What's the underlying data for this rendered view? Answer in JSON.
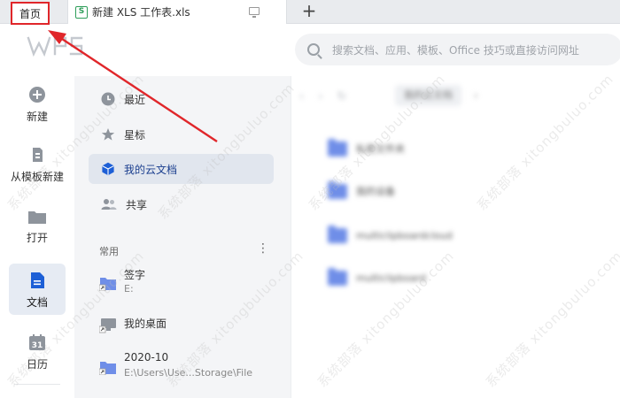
{
  "tabs": {
    "home_label": "首页",
    "file_label": "新建 XLS 工作表.xls",
    "file_icon": "S",
    "new_tab": "+"
  },
  "search": {
    "placeholder": "搜索文档、应用、模板、Office 技巧或直接访问网址"
  },
  "rail": {
    "items": [
      {
        "label": "新建"
      },
      {
        "label": "从模板新建"
      },
      {
        "label": "打开"
      },
      {
        "label": "文档"
      },
      {
        "label": "日历"
      }
    ],
    "calendar_day": "31"
  },
  "nav": {
    "items": [
      {
        "label": "最近"
      },
      {
        "label": "星标"
      },
      {
        "label": "我的云文档"
      },
      {
        "label": "共享"
      }
    ],
    "section_title": "常用",
    "section_more": "⋮",
    "recent": [
      {
        "title": "签字",
        "sub": "E:"
      },
      {
        "title": "我的桌面",
        "sub": ""
      },
      {
        "title": "2020-10",
        "sub": "E:\\Users\\Use...Storage\\File"
      }
    ]
  },
  "main": {
    "crumb_arrows": "‹ › ↻",
    "crumb": "我的云文档",
    "crumb_chev": "›",
    "folders": [
      {
        "name": "私密文件夹"
      },
      {
        "name": "我的设备"
      },
      {
        "name": "multiclipboardcloud"
      },
      {
        "name": "multiclipboard"
      }
    ]
  },
  "watermark": "系统部落 xitongbuluo.com",
  "colors": {
    "annotation": "#e0262a",
    "accent": "#1d5fd6",
    "folder": "#6f8ee8"
  }
}
